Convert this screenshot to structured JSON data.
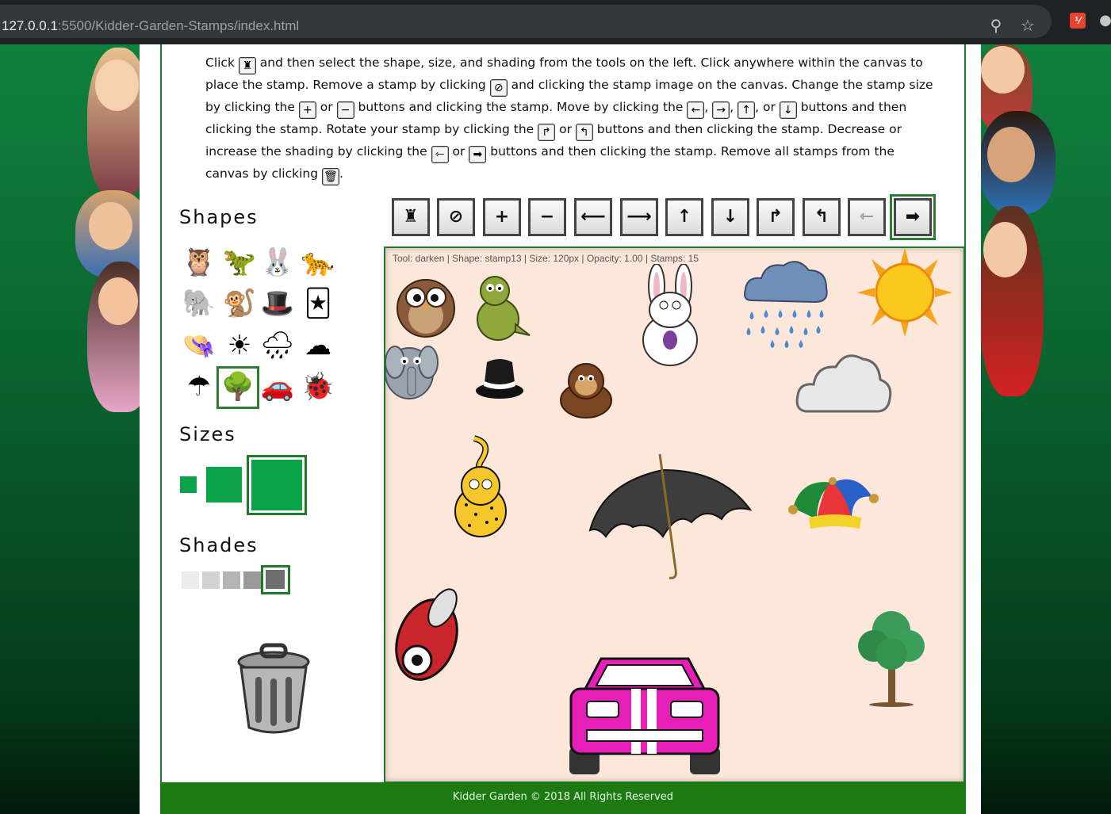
{
  "browser": {
    "url_host": "127.0.0.1",
    "url_path": ":5500/Kidder-Garden-Stamps/index.html",
    "extension_label": "⅟"
  },
  "instructions": {
    "p1": "Click",
    "p2": " and then select the shape, size, and shading from the tools on the left. Click anywhere within the canvas to place the stamp. Remove a stamp by clicking",
    "p3": " and clicking the stamp image on the canvas. Change the stamp size by clicking the",
    "p4": " or ",
    "p5": " buttons and clicking the stamp. Move by clicking the",
    "p6": ",",
    "p7": ",",
    "p8": ", or ",
    "p9": " buttons and then clicking the stamp. Rotate your stamp by clicking the",
    "p10": " or ",
    "p11": " buttons and then clicking the stamp. Decrease or increase the shading by clicking the",
    "p12": " or ",
    "p13": " buttons and then clicking the stamp. Remove all stamps from the canvas by clicking",
    "p14": "."
  },
  "sections": {
    "shapes": "Shapes",
    "sizes": "Sizes",
    "shades": "Shades"
  },
  "shapes": [
    "owl",
    "dinosaur",
    "bunny",
    "leopard",
    "elephant",
    "monkey",
    "top hat",
    "jester hat",
    "bowler hat",
    "sun",
    "rain cloud",
    "cloud",
    "umbrella",
    "tree",
    "car",
    "ladybug"
  ],
  "selected_shape": "tree",
  "toolbar": {
    "icons": [
      "stamp-icon",
      "remove-icon",
      "plus-icon",
      "minus-icon",
      "arrow-left-icon",
      "arrow-right-icon",
      "arrow-up-icon",
      "arrow-down-icon",
      "rotate-right-icon",
      "rotate-left-icon",
      "lighten-icon",
      "darken-icon"
    ],
    "glyphs": [
      "♜",
      "⃠",
      "+",
      "−",
      "⟵",
      "⟶",
      "↑",
      "↓",
      "↱",
      "↰",
      "⇽",
      "➡"
    ],
    "active": "darken-icon"
  },
  "canvas": {
    "status": "Tool: darken | Shape: stamp13 | Size: 120px | Opacity: 1.00 | Stamps: 15",
    "background": "#fde6da"
  },
  "footer": {
    "text": "Kidder Garden © 2018 All Rights Reserved"
  },
  "colors": {
    "accent_green": "#1f7a2b",
    "size_green": "#0aa34a",
    "footer_green": "#1d7a12"
  }
}
